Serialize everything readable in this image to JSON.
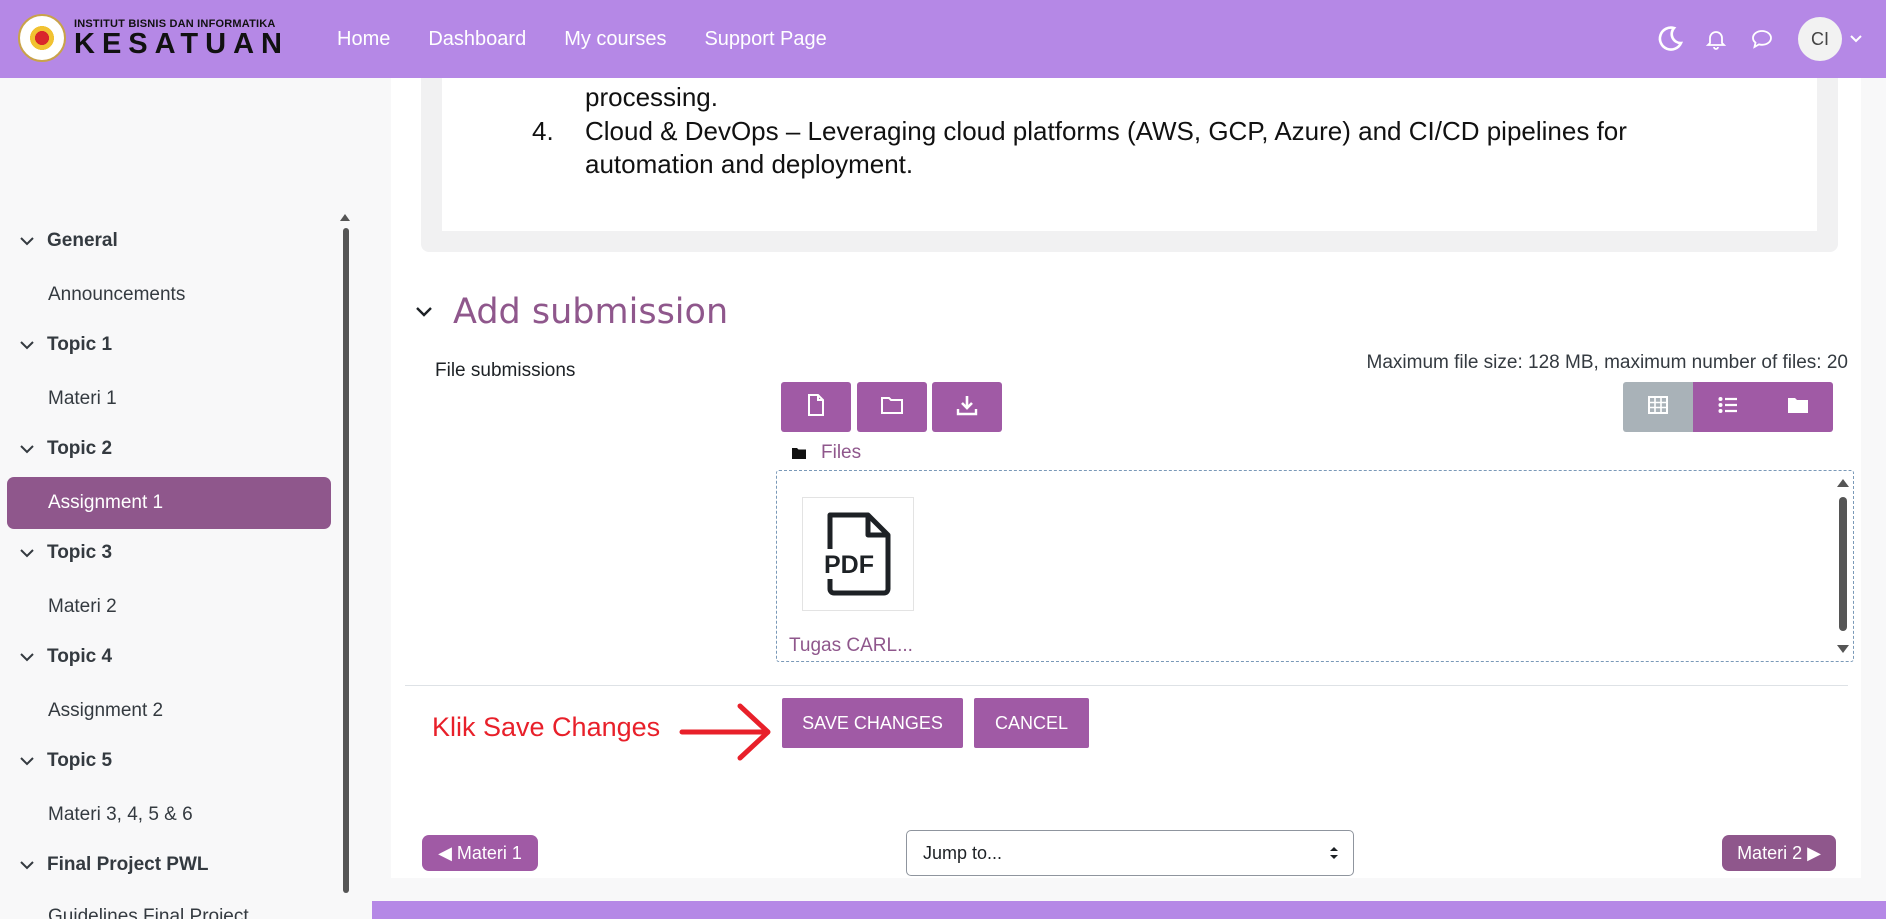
{
  "brand": {
    "small": "INSTITUT BISNIS DAN INFORMATIKA",
    "big": "KESATUAN"
  },
  "nav": {
    "links": [
      "Home",
      "Dashboard",
      "My courses",
      "Support Page"
    ],
    "avatar_initials": "CI"
  },
  "sidebar": {
    "sections": [
      {
        "title": "General",
        "items": [
          "Announcements"
        ]
      },
      {
        "title": "Topic 1",
        "items": [
          "Materi 1"
        ]
      },
      {
        "title": "Topic 2",
        "items": [
          "Assignment 1"
        ]
      },
      {
        "title": "Topic 3",
        "items": [
          "Materi 2"
        ]
      },
      {
        "title": "Topic 4",
        "items": [
          "Assignment 2"
        ]
      },
      {
        "title": "Topic 5",
        "items": [
          "Materi 3, 4, 5 & 6"
        ]
      },
      {
        "title": "Final Project PWL",
        "items": [
          "Guidelines Final Project"
        ]
      }
    ],
    "active_item": "Assignment 1"
  },
  "document": {
    "line_prev_tail": "processing.",
    "item_number": "4.",
    "item_line1": "Cloud & DevOps – Leveraging cloud platforms (AWS, GCP, Azure) and CI/CD pipelines for",
    "item_line2": "automation and deployment."
  },
  "submission": {
    "heading": "Add submission",
    "field_label": "File submissions",
    "max_info": "Maximum file size: 128 MB, maximum number of files: 20",
    "files_crumb": "Files",
    "file_name": "Tugas CARL...",
    "file_type_label": "PDF",
    "save_label": "SAVE CHANGES",
    "cancel_label": "CANCEL"
  },
  "annotation": {
    "text": "Klik Save Changes",
    "color": "#e8202a"
  },
  "activity_nav": {
    "prev_label": "◀ Materi 1",
    "next_label": "Materi 2 ▶",
    "jump_placeholder": "Jump to..."
  },
  "colors": {
    "navbar": "#b588e6",
    "primary": "#a05aa5",
    "active": "#8f578c"
  }
}
